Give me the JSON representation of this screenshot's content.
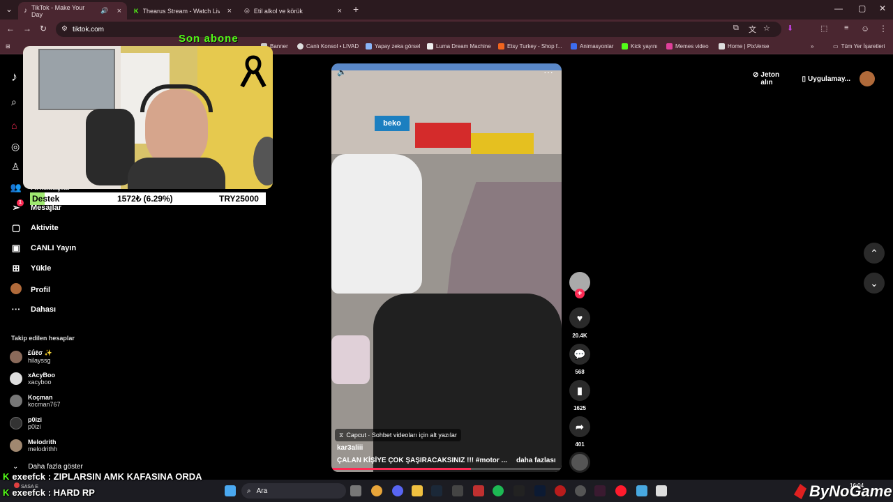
{
  "browser": {
    "tabs": [
      {
        "label": "TikTok - Make Your Day",
        "active": true
      },
      {
        "label": "Thearus Stream - Watch Live on",
        "active": false
      },
      {
        "label": "Etil alkol ve körük",
        "active": false
      }
    ],
    "url": "tiktok.com",
    "bookmarks": [
      "Banner",
      "Canlı Konsol • LIVAD",
      "Yapay zeka görsel",
      "Luma Dream Machine",
      "Etsy Turkey - Shop f...",
      "Animasyonlar",
      "Kick yayını",
      "Memes video",
      "Home | PixVerse",
      "Tüm Yer İşaretleri"
    ]
  },
  "overlay": {
    "son_abone": "Son abone",
    "destek_label": "Destek",
    "destek_amount": "1572₺ (6.29%)",
    "destek_goal": "TRY25000"
  },
  "sidebar": {
    "items": [
      {
        "label": "Arkadaşlar",
        "icon": "friends-icon"
      },
      {
        "label": "Mesajlar",
        "icon": "messages-icon",
        "badge": "1"
      },
      {
        "label": "Aktivite",
        "icon": "activity-icon"
      },
      {
        "label": "CANLI Yayın",
        "icon": "live-icon"
      },
      {
        "label": "Yükle",
        "icon": "upload-icon"
      },
      {
        "label": "Profil",
        "icon": "profile-icon"
      },
      {
        "label": "Dahası",
        "icon": "more-icon"
      }
    ],
    "following_title": "Takip edilen hesaplar",
    "following": [
      {
        "name": "£ǘℓσ ✨",
        "handle": "hilayssg"
      },
      {
        "name": "xAcyBoo",
        "handle": "xacyboo"
      },
      {
        "name": "Koçman",
        "handle": "kocman767"
      },
      {
        "name": "p0izi",
        "handle": "p0izi"
      },
      {
        "name": "Melodrith",
        "handle": "melodrithh"
      }
    ],
    "show_more": "Daha fazla göster"
  },
  "header": {
    "coins": "Jeton alın",
    "app": "Uygulamay..."
  },
  "video": {
    "capcut": "Capcut · Sohbet videoları için alt yazılar",
    "author": "kar3aliii",
    "caption": "ÇALAN KİŞİYE ÇOK ŞAŞIRACAKSINIZ !!! #motor ...",
    "more": "daha fazlası",
    "likes": "20.4K",
    "comments": "568",
    "saves": "1625",
    "shares": "401"
  },
  "chat": [
    {
      "user": "exeefck",
      "message": "ZIPLARSIN AMK KAFASINA ORDA"
    },
    {
      "user": "exeefck",
      "message": "HARD RP"
    }
  ],
  "taskbar": {
    "search": "Ara",
    "time": "16:04",
    "brand": "ByNoGame",
    "sasa": "SASA E"
  }
}
